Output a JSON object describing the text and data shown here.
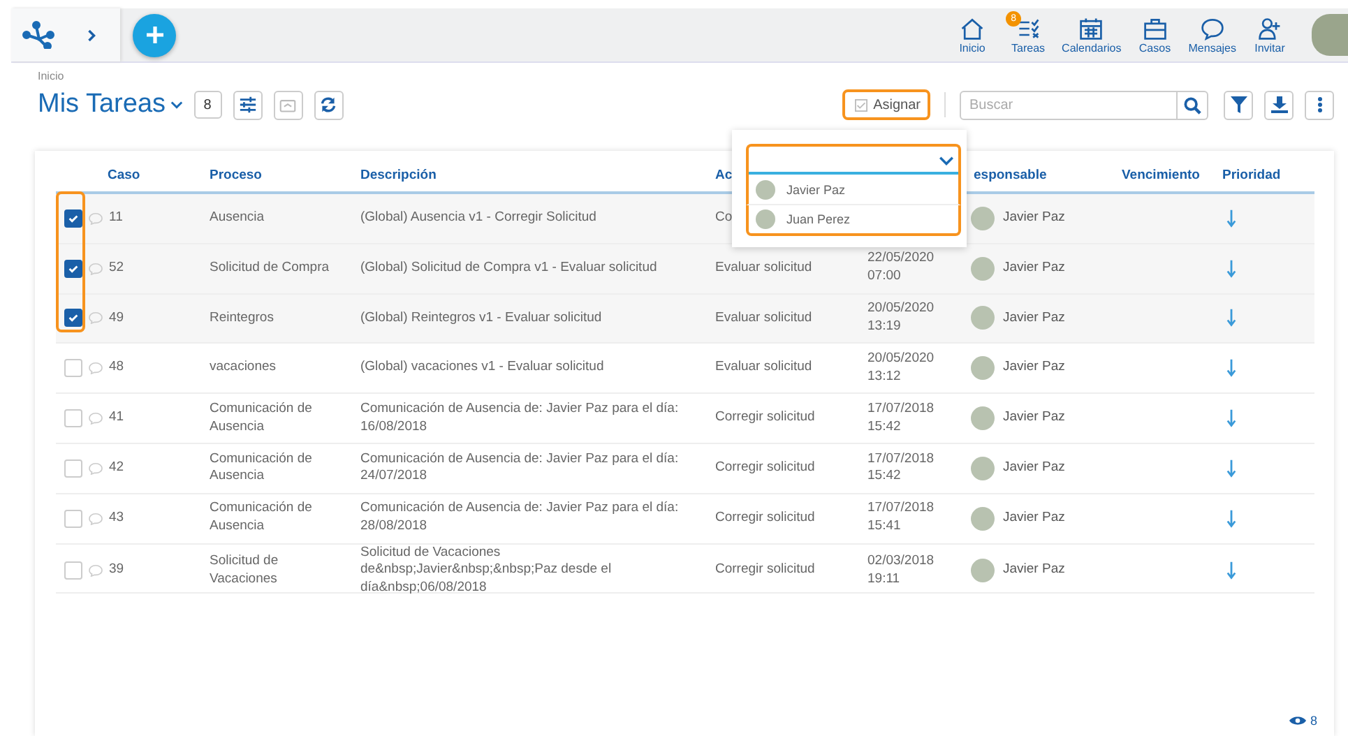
{
  "topbar": {
    "nav": [
      {
        "kind": "home",
        "label": "Inicio"
      },
      {
        "kind": "tasks",
        "label": "Tareas",
        "badge": "8"
      },
      {
        "kind": "calendar",
        "label": "Calendarios"
      },
      {
        "kind": "briefcase",
        "label": "Casos"
      },
      {
        "kind": "chat",
        "label": "Mensajes"
      },
      {
        "kind": "invite",
        "label": "Invitar"
      }
    ]
  },
  "breadcrumb": "Inicio",
  "title": "Mis Tareas",
  "count": "8",
  "toolbar": {
    "assign_label": "Asignar",
    "search_placeholder": "Buscar"
  },
  "assign_dropdown": {
    "options": [
      "Javier Paz",
      "Juan Perez"
    ]
  },
  "table": {
    "columns": {
      "caso": "Caso",
      "proceso": "Proceso",
      "descripcion": "Descripción",
      "actividad": "Ac",
      "responsable": "esponsable",
      "vencimiento": "Vencimiento",
      "prioridad": "Prioridad"
    },
    "rows": [
      {
        "checked": true,
        "caso": "11",
        "proceso": "Ausencia",
        "descripcion": "(Global) Ausencia v1 - Corregir Solicitud",
        "actividad": "Co",
        "responsable": "Javier Paz"
      },
      {
        "checked": true,
        "caso": "52",
        "proceso": "Solicitud de Compra",
        "descripcion": "(Global) Solicitud de Compra v1 - Evaluar solicitud",
        "actividad": "Evaluar solicitud",
        "fecha": "22/05/2020 07:00",
        "responsable": "Javier Paz"
      },
      {
        "checked": true,
        "caso": "49",
        "proceso": "Reintegros",
        "descripcion": "(Global) Reintegros v1 - Evaluar solicitud",
        "actividad": "Evaluar solicitud",
        "fecha": "20/05/2020 13:19",
        "responsable": "Javier Paz"
      },
      {
        "checked": false,
        "caso": "48",
        "proceso": "vacaciones",
        "descripcion": "(Global) vacaciones v1 - Evaluar solicitud",
        "actividad": "Evaluar solicitud",
        "fecha": "20/05/2020 13:12",
        "responsable": "Javier Paz"
      },
      {
        "checked": false,
        "caso": "41",
        "proceso": "Comunicación de Ausencia",
        "descripcion": "Comunicación de Ausencia de: Javier Paz para el día: 16/08/2018",
        "actividad": "Corregir solicitud",
        "fecha": "17/07/2018 15:42",
        "responsable": "Javier Paz"
      },
      {
        "checked": false,
        "caso": "42",
        "proceso": "Comunicación de Ausencia",
        "descripcion": "Comunicación de Ausencia de: Javier Paz para el día: 24/07/2018",
        "actividad": "Corregir solicitud",
        "fecha": "17/07/2018 15:42",
        "responsable": "Javier Paz"
      },
      {
        "checked": false,
        "caso": "43",
        "proceso": "Comunicación de Ausencia",
        "descripcion": "Comunicación de Ausencia de: Javier Paz para el día: 28/08/2018",
        "actividad": "Corregir solicitud",
        "fecha": "17/07/2018 15:41",
        "responsable": "Javier Paz"
      },
      {
        "checked": false,
        "caso": "39",
        "proceso": "Solicitud de Vacaciones",
        "descripcion": "Solicitud de Vacaciones de&nbsp;Javier&nbsp;&nbsp;Paz desde el día&nbsp;06/08/2018",
        "actividad": "Corregir solicitud",
        "fecha": "02/03/2018 19:11",
        "responsable": "Javier Paz"
      }
    ]
  },
  "footer": {
    "views": "8"
  }
}
